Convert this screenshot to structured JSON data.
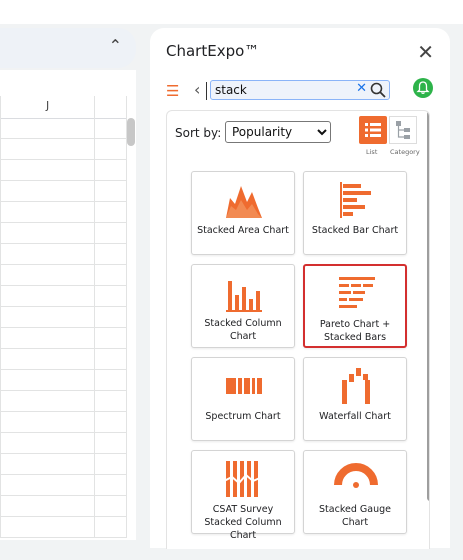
{
  "sheet": {
    "column_label": "J"
  },
  "panel": {
    "title": "ChartExpo™",
    "search": {
      "value": "stack",
      "placeholder": ""
    },
    "sort_by_label": "Sort by:",
    "sort_options": [
      "Popularity"
    ],
    "sort_selected": "Popularity",
    "view_list_label": "List",
    "view_category_label": "Category"
  },
  "charts": [
    {
      "label": "Stacked Area Chart",
      "icon": "stacked-area-chart-icon"
    },
    {
      "label": "Stacked Bar Chart",
      "icon": "stacked-bar-chart-icon"
    },
    {
      "label": "Stacked Column Chart",
      "icon": "stacked-column-chart-icon"
    },
    {
      "label": "Pareto Chart + Stacked Bars",
      "icon": "pareto-chart-stacked-bars-icon",
      "selected": true
    },
    {
      "label": "Spectrum Chart",
      "icon": "spectrum-chart-icon"
    },
    {
      "label": "Waterfall Chart",
      "icon": "waterfall-chart-icon"
    },
    {
      "label": "CSAT Survey Stacked Column Chart",
      "icon": "csat-survey-stacked-column-chart-icon"
    },
    {
      "label": "Stacked Gauge Chart",
      "icon": "stacked-gauge-chart-icon"
    }
  ],
  "colors": {
    "accent": "#ef6b2f",
    "selected_border": "#d32f2f",
    "notification": "#2db34a"
  }
}
